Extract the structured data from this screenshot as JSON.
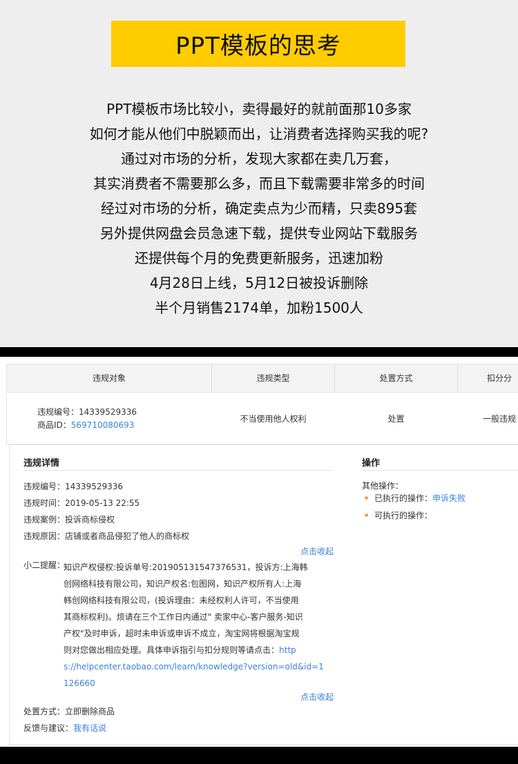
{
  "header": {
    "title": "PPT模板的思考"
  },
  "story_lines": [
    "PPT模板市场比较小，卖得最好的就前面那10多家",
    "如何才能从他们中脱颖而出，让消费者选择购买我的呢?",
    "通过对市场的分析，发现大家都在卖几万套，",
    "其实消费者不需要那么多，而且下载需要非常多的时间",
    "经过对市场的分析，确定卖点为少而精，只卖895套",
    "另外提供网盘会员急速下载，提供专业网站下载服务",
    "还提供每个月的免费更新服务，迅速加粉",
    "4月28日上线，5月12日被投诉删除",
    "半个月销售2174单，加粉1500人"
  ],
  "table": {
    "headers": [
      "违规对象",
      "违规类型",
      "处置方式",
      "扣分分"
    ],
    "row": {
      "violation_no_label": "违规编号：",
      "violation_no": "14339529336",
      "item_id_label": "商品ID：",
      "item_id": "569710080693",
      "type": "不当使用他人权利",
      "action": "处置",
      "score": "一般违规"
    }
  },
  "detail": {
    "title": "违规详情",
    "fields": [
      {
        "label": "违规编号：",
        "value": "14339529336"
      },
      {
        "label": "违规时间：",
        "value": "2019-05-13 22:55"
      },
      {
        "label": "违规案例：",
        "value": "投诉商标侵权"
      },
      {
        "label": "违规原因：",
        "value": "店铺或者商品侵犯了他人的商标权"
      }
    ],
    "collapse_label": "点击收起",
    "tip_label": "小二提醒：",
    "tip_lines": [
      "知识产权侵权:投诉单号:201905131547376531，投诉方:上海韩",
      "创网络科技有限公司，知识产权名:包图网，知识产权所有人:上海",
      "韩创网络科技有限公司，(投诉理由：未经权利人许可，不当使用",
      "其商标权利)。烦请在三个工作日内通过\" 卖家中心-客户服务-知识",
      "产权\"及时申诉，超时未申诉或申诉不成立，淘宝网将根据淘宝规",
      "则对您做出相应处理。具体申诉指引与扣分规则等请点击："
    ],
    "tip_link_start": "http",
    "tip_link_lines": [
      "s://helpcenter.taobao.com/learn/knowledge?version=old&id=1",
      "126660"
    ],
    "collapse_label_2": "点击收起",
    "disposal_label": "处置方式：",
    "disposal_value": "立即删除商品",
    "feedback_label": "反馈与建议：",
    "feedback_link": "我有话说"
  },
  "ops": {
    "title": "操作",
    "other_label": "其他操作：",
    "executed_label": "已执行的操作：",
    "executed_value": "申诉失败",
    "available_label": "可执行的操作："
  },
  "colors": {
    "title_bg": "#ffcc00",
    "link": "#3c7fd9",
    "bullet": "#f0a050"
  }
}
